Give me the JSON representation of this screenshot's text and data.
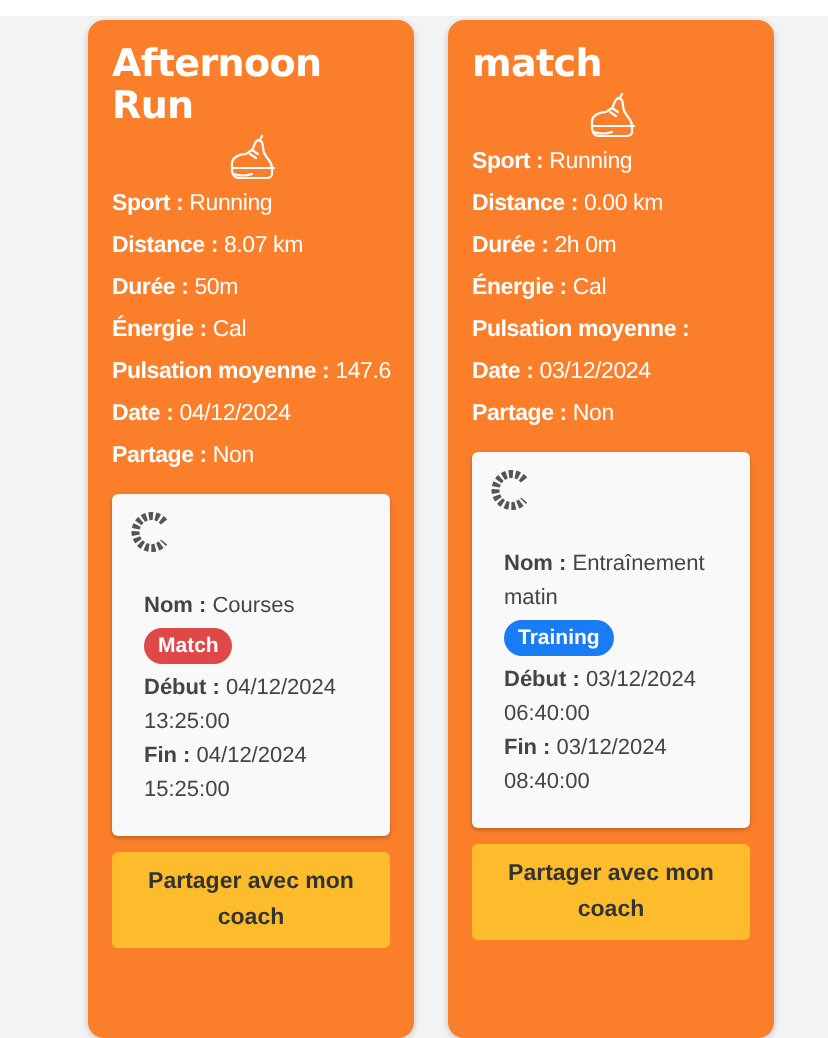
{
  "activities": [
    {
      "title": "Afternoon Run",
      "fields": [
        {
          "label": "Sport :",
          "value": "Running"
        },
        {
          "label": "Distance :",
          "value": "8.07 km"
        },
        {
          "label": "Durée :",
          "value": "50m"
        },
        {
          "label": "Énergie :",
          "value": "Cal"
        },
        {
          "label": "Pulsation moyenne :",
          "value": "147.6"
        },
        {
          "label": "Date :",
          "value": "04/12/2024"
        },
        {
          "label": "Partage :",
          "value": "Non"
        }
      ],
      "event": {
        "name_label": "Nom :",
        "name": "Courses",
        "tag": {
          "text": "Match",
          "color": "#e04848"
        },
        "start_label": "Début :",
        "start": "04/12/2024 13:25:00",
        "end_label": "Fin :",
        "end": "04/12/2024 15:25:00"
      },
      "button": "Partager avec mon coach"
    },
    {
      "title": "match",
      "fields": [
        {
          "label": "Sport :",
          "value": "Running"
        },
        {
          "label": "Distance :",
          "value": "0.00 km"
        },
        {
          "label": "Durée :",
          "value": "2h 0m"
        },
        {
          "label": "Énergie :",
          "value": "Cal"
        },
        {
          "label": "Pulsation moyenne :"
        },
        {
          "label": "Date :",
          "value": "03/12/2024"
        },
        {
          "label": "Partage :",
          "value": "Non"
        }
      ],
      "event": {
        "name_label": "Nom :",
        "name": "Entraînement matin",
        "tag": {
          "text": "Training",
          "color": "#1a7cf5"
        },
        "start_label": "Début :",
        "start": "03/12/2024 06:40:00",
        "end_label": "Fin :",
        "end": "03/12/2024 08:40:00"
      },
      "button": "Partager avec mon coach"
    }
  ]
}
